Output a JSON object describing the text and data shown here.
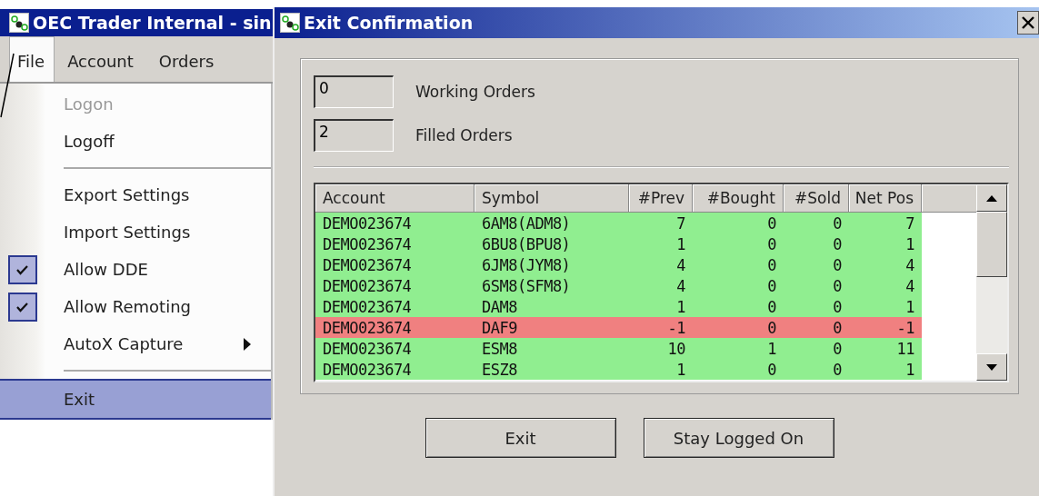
{
  "app_window": {
    "title": "OEC Trader Internal - sin"
  },
  "menu_bar": [
    {
      "label": "File",
      "selected": true
    },
    {
      "label": "Account",
      "selected": false
    },
    {
      "label": "Orders",
      "selected": false
    }
  ],
  "file_menu": [
    {
      "kind": "item",
      "label": "Logon",
      "disabled": true,
      "checked": false,
      "submenu": false,
      "selected": false
    },
    {
      "kind": "item",
      "label": "Logoff",
      "disabled": false,
      "checked": false,
      "submenu": false,
      "selected": false
    },
    {
      "kind": "separator"
    },
    {
      "kind": "item",
      "label": "Export Settings",
      "disabled": false,
      "checked": false,
      "submenu": false,
      "selected": false
    },
    {
      "kind": "item",
      "label": "Import Settings",
      "disabled": false,
      "checked": false,
      "submenu": false,
      "selected": false
    },
    {
      "kind": "item",
      "label": "Allow DDE",
      "disabled": false,
      "checked": true,
      "submenu": false,
      "selected": false
    },
    {
      "kind": "item",
      "label": "Allow Remoting",
      "disabled": false,
      "checked": true,
      "submenu": false,
      "selected": false
    },
    {
      "kind": "item",
      "label": "AutoX Capture",
      "disabled": false,
      "checked": false,
      "submenu": true,
      "selected": false
    },
    {
      "kind": "separator"
    },
    {
      "kind": "item",
      "label": "Exit",
      "disabled": false,
      "checked": false,
      "submenu": false,
      "selected": true
    }
  ],
  "dialog": {
    "title": "Exit Confirmation",
    "counters": [
      {
        "value": "0",
        "label": "Working Orders"
      },
      {
        "value": "2",
        "label": "Filled Orders"
      }
    ],
    "table": {
      "columns": [
        "Account",
        "Symbol",
        "#Prev",
        "#Bought",
        "#Sold",
        "Net Pos"
      ],
      "rows": [
        {
          "color": "#90ee90",
          "cells": [
            "DEMO023674",
            "6AM8(ADM8)",
            "7",
            "0",
            "0",
            "7"
          ]
        },
        {
          "color": "#90ee90",
          "cells": [
            "DEMO023674",
            "6BU8(BPU8)",
            "1",
            "0",
            "0",
            "1"
          ]
        },
        {
          "color": "#90ee90",
          "cells": [
            "DEMO023674",
            "6JM8(JYM8)",
            "4",
            "0",
            "0",
            "4"
          ]
        },
        {
          "color": "#90ee90",
          "cells": [
            "DEMO023674",
            "6SM8(SFM8)",
            "4",
            "0",
            "0",
            "4"
          ]
        },
        {
          "color": "#90ee90",
          "cells": [
            "DEMO023674",
            "DAM8",
            "1",
            "0",
            "0",
            "1"
          ]
        },
        {
          "color": "#f08080",
          "cells": [
            "DEMO023674",
            "DAF9",
            "-1",
            "0",
            "0",
            "-1"
          ]
        },
        {
          "color": "#90ee90",
          "cells": [
            "DEMO023674",
            "ESM8",
            "10",
            "1",
            "0",
            "11"
          ]
        },
        {
          "color": "#90ee90",
          "cells": [
            "DEMO023674",
            "ESZ8",
            "1",
            "0",
            "0",
            "1"
          ]
        }
      ]
    },
    "buttons": [
      "Exit",
      "Stay Logged On"
    ]
  }
}
